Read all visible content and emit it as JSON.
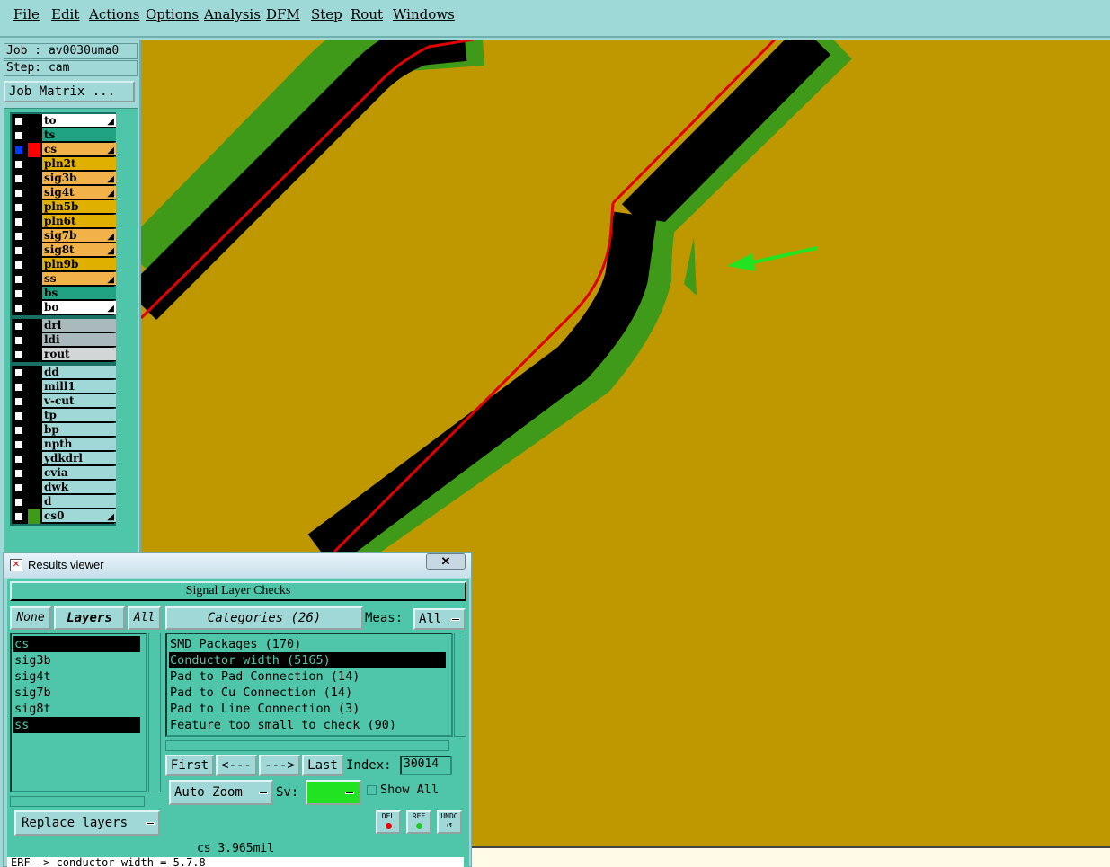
{
  "menu": {
    "file": "File",
    "edit": "Edit",
    "actions": "Actions",
    "options": "Options",
    "analysis": "Analysis",
    "dfm": "DFM",
    "step": "Step",
    "rout": "Rout",
    "windows": "Windows"
  },
  "job": {
    "job_line": "Job : av0030uma0",
    "step_line": "Step: cam",
    "matrix_button": "Job Matrix ..."
  },
  "layers": {
    "board": [
      {
        "name": "to",
        "color": "#ffffff",
        "mark": true
      },
      {
        "name": "ts",
        "color": "#1fa383",
        "mark": false
      },
      {
        "name": "cs",
        "color": "#f2b24a",
        "mark": true
      },
      {
        "name": "pln2t",
        "color": "#e0b000",
        "mark": false
      },
      {
        "name": "sig3b",
        "color": "#f2b24a",
        "mark": true
      },
      {
        "name": "sig4t",
        "color": "#f2b24a",
        "mark": true
      },
      {
        "name": "pln5b",
        "color": "#e0b000",
        "mark": false
      },
      {
        "name": "pln6t",
        "color": "#e0b000",
        "mark": false
      },
      {
        "name": "sig7b",
        "color": "#f2b24a",
        "mark": true
      },
      {
        "name": "sig8t",
        "color": "#f2b24a",
        "mark": true
      },
      {
        "name": "pln9b",
        "color": "#e0b000",
        "mark": false
      },
      {
        "name": "ss",
        "color": "#f2b24a",
        "mark": true
      },
      {
        "name": "bs",
        "color": "#1fa383",
        "mark": false
      },
      {
        "name": "bo",
        "color": "#ffffff",
        "mark": true
      }
    ],
    "drill": [
      {
        "name": "drl",
        "color": "#a9b9bc"
      },
      {
        "name": "ldi",
        "color": "#a9b9bc"
      },
      {
        "name": "rout",
        "color": "#d2d6d6"
      }
    ],
    "misc": [
      {
        "name": "dd",
        "color": "#9fd8d6"
      },
      {
        "name": "mill1",
        "color": "#9fd8d6"
      },
      {
        "name": "v-cut",
        "color": "#9fd8d6"
      },
      {
        "name": "tp",
        "color": "#9fd8d6"
      },
      {
        "name": "bp",
        "color": "#9fd8d6"
      },
      {
        "name": "npth",
        "color": "#9fd8d6"
      },
      {
        "name": "ydkdrl",
        "color": "#9fd8d6"
      },
      {
        "name": "cvia",
        "color": "#9fd8d6"
      },
      {
        "name": "dwk",
        "color": "#9fd8d6"
      },
      {
        "name": "d",
        "color": "#9fd8d6"
      },
      {
        "name": "cs0",
        "color": "#9fd8d6",
        "mark": true
      }
    ]
  },
  "results_viewer": {
    "title": "Results viewer",
    "close_label": "✕",
    "header": "Signal Layer Checks",
    "none_label": "None",
    "layers_label": "Layers",
    "all_label": "All",
    "categories_label": "Categories (26)",
    "meas_label": "Meas:",
    "meas_value": "All",
    "layer_items": [
      {
        "text": "cs",
        "selected": true
      },
      {
        "text": "sig3b",
        "selected": false
      },
      {
        "text": "sig4t",
        "selected": false
      },
      {
        "text": "sig7b",
        "selected": false
      },
      {
        "text": "sig8t",
        "selected": false
      },
      {
        "text": "ss",
        "selected": true
      }
    ],
    "category_items": [
      {
        "text": "SMD Packages (170)",
        "selected": false
      },
      {
        "text": "Conductor width (5165)",
        "selected": true
      },
      {
        "text": "Pad to Pad Connection (14)",
        "selected": false
      },
      {
        "text": "Pad to Cu Connection (14)",
        "selected": false
      },
      {
        "text": "Pad to Line Connection (3)",
        "selected": false
      },
      {
        "text": "Feature too small to check (90)",
        "selected": false
      }
    ],
    "first_label": "First",
    "prev_label": "<---",
    "next_label": "--->",
    "last_label": "Last",
    "index_label": "Index:",
    "index_value": "30014",
    "autozoom_label": "Auto Zoom",
    "sv_label": "Sv:",
    "sv_color": "#22e322",
    "show_all_label": "Show All",
    "replace_label": "Replace layers",
    "del_label": "DEL",
    "ref_label": "REF",
    "undo_label": "UNDO",
    "status": "cs 3.965mil",
    "message": "ERF--> conductor width = 5.7.8"
  }
}
